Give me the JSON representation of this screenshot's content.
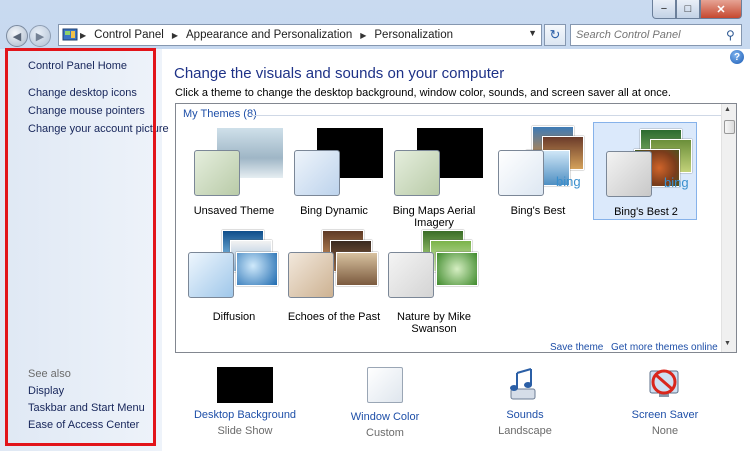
{
  "window": {
    "min_label": "−",
    "max_label": "□",
    "close_label": "✕"
  },
  "nav": {
    "back_icon": "◀",
    "forward_icon": "▶",
    "breadcrumb": [
      "Control Panel",
      "Appearance and Personalization",
      "Personalization"
    ],
    "refresh_icon": "↻",
    "search_placeholder": "Search Control Panel",
    "search_icon": "⚲"
  },
  "sidebar": {
    "home": "Control Panel Home",
    "links": [
      "Change desktop icons",
      "Change mouse pointers",
      "Change your account picture"
    ],
    "see_also_label": "See also",
    "see_also": [
      "Display",
      "Taskbar and Start Menu",
      "Ease of Access Center"
    ]
  },
  "main": {
    "help_label": "?",
    "title": "Change the visuals and sounds on your computer",
    "subtitle": "Click a theme to change the desktop background, window color, sounds, and screen saver all at once.",
    "group_label": "My Themes (8)",
    "themes": [
      {
        "name": "Unsaved Theme",
        "selected": false
      },
      {
        "name": "Bing Dynamic",
        "selected": false
      },
      {
        "name": "Bing Maps Aerial Imagery",
        "selected": false
      },
      {
        "name": "Bing's Best",
        "selected": false
      },
      {
        "name": "Bing's Best 2",
        "selected": true
      },
      {
        "name": "Diffusion",
        "selected": false
      },
      {
        "name": "Echoes of the Past",
        "selected": false
      },
      {
        "name": "Nature by Mike Swanson",
        "selected": false
      }
    ],
    "save_theme": "Save theme",
    "get_more": "Get more themes online",
    "bing_logo": "bing"
  },
  "bottom": [
    {
      "label": "Desktop Background",
      "value": "Slide Show",
      "icon": "black-swatch-icon"
    },
    {
      "label": "Window Color",
      "value": "Custom",
      "icon": "color-swatch-icon"
    },
    {
      "label": "Sounds",
      "value": "Landscape",
      "icon": "music-notes-icon"
    },
    {
      "label": "Screen Saver",
      "value": "None",
      "icon": "no-screensaver-icon"
    }
  ],
  "colors": {
    "accent": "#1e3287",
    "link": "#1e4fa8",
    "highlight_box": "#e2141a",
    "selection": "#dbe9fb"
  }
}
